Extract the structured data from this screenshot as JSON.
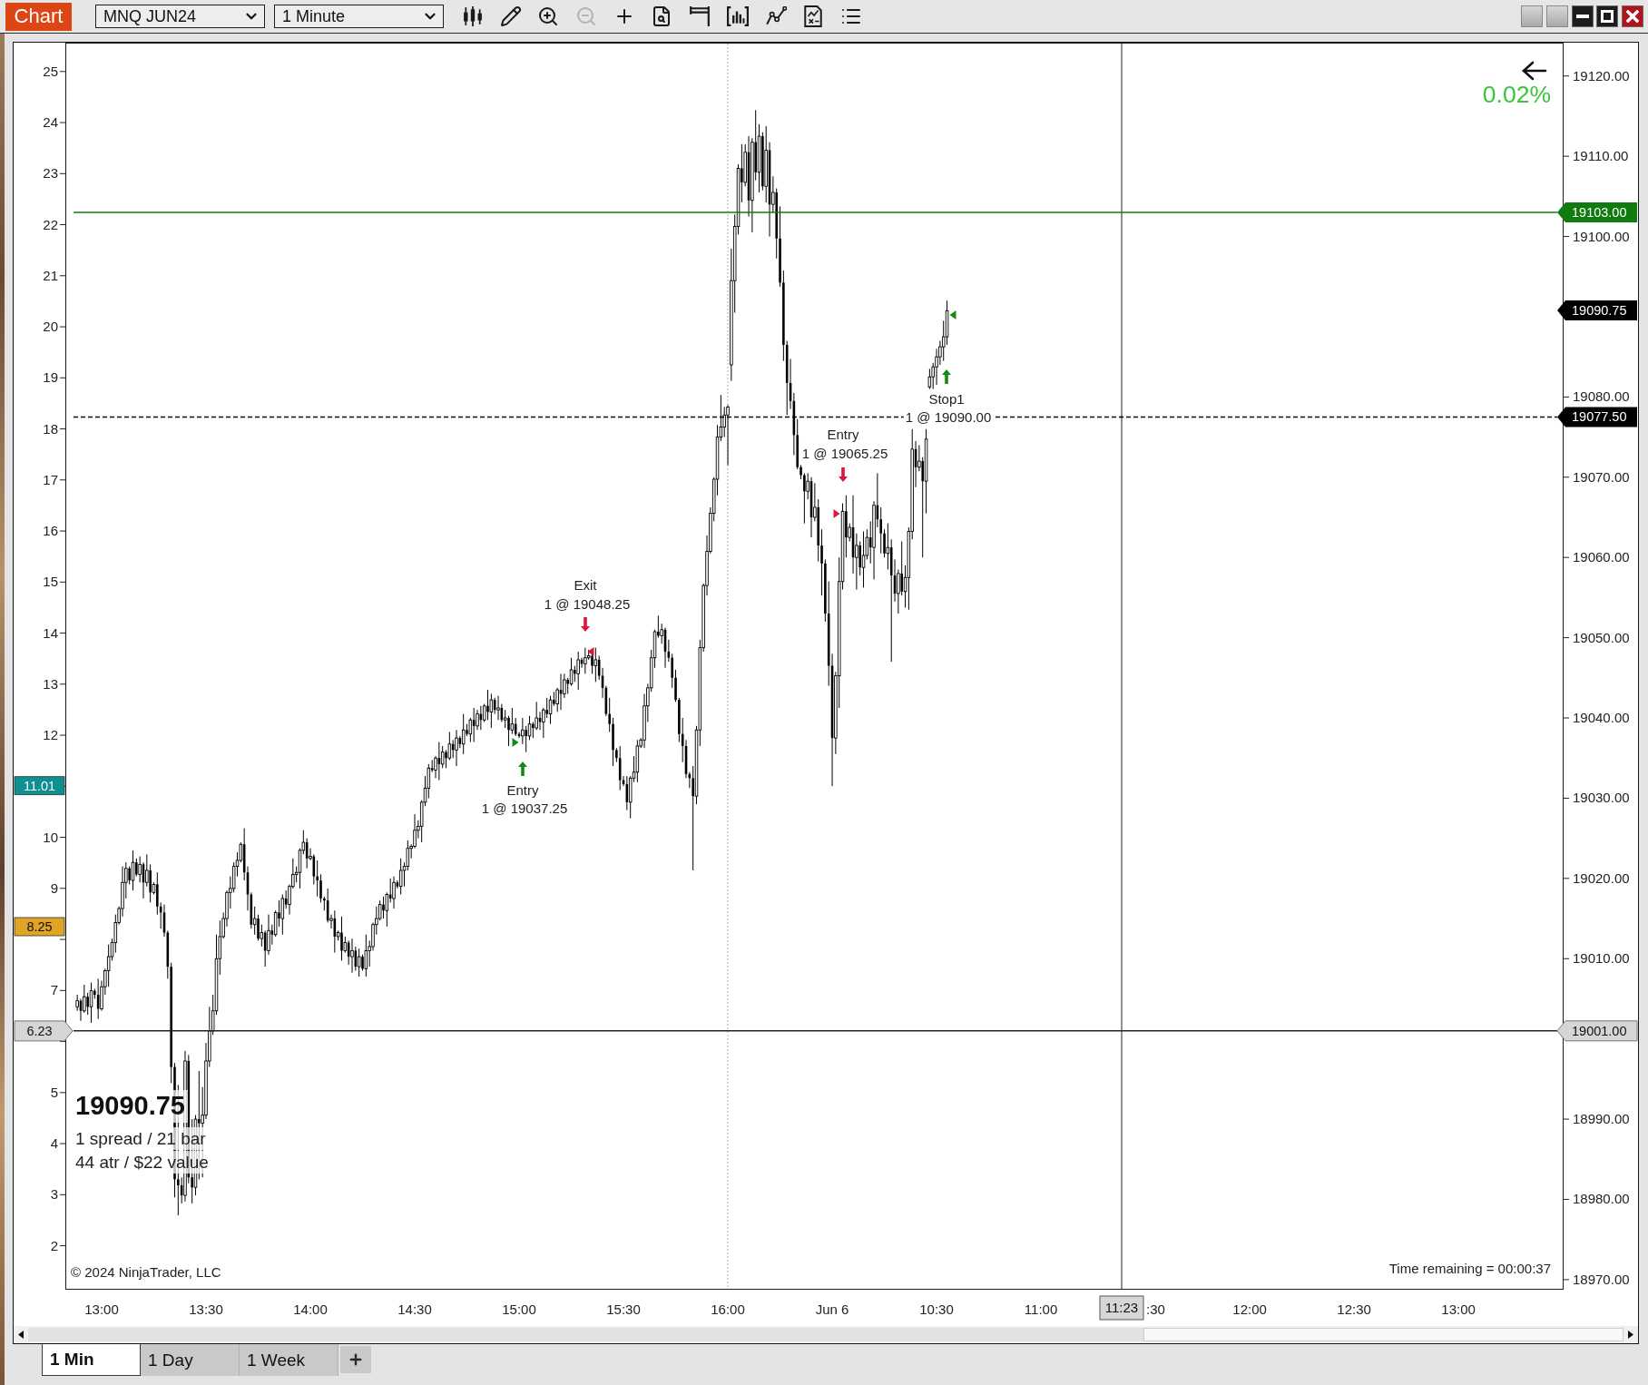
{
  "toolbar": {
    "title": "Chart",
    "instrument": {
      "value": "MNQ JUN24"
    },
    "interval": {
      "value": "1 Minute"
    },
    "tools": [
      {
        "disabled": false
      },
      {
        "disabled": false
      },
      {
        "disabled": false
      },
      {
        "disabled": true
      },
      {
        "disabled": false
      },
      {
        "disabled": false
      },
      {
        "disabled": false
      },
      {
        "disabled": false
      },
      {
        "disabled": false
      },
      {
        "disabled": false
      },
      {
        "disabled": false
      }
    ]
  },
  "chart": {
    "chart_data": {
      "type": "candlestick",
      "categories": [
        null,
        null,
        null,
        null,
        null,
        null,
        null,
        "13:00",
        null,
        null,
        null,
        null,
        null,
        null,
        null,
        null,
        null,
        null,
        null,
        null,
        null,
        null,
        null,
        null,
        null,
        null,
        null,
        null,
        null,
        null,
        null,
        null,
        null,
        null,
        null,
        null,
        null,
        "13:30",
        null,
        null,
        null,
        null,
        null,
        null,
        null,
        null,
        null,
        null,
        null,
        null,
        null,
        null,
        null,
        null,
        null,
        null,
        null,
        null,
        null,
        null,
        null,
        null,
        null,
        null,
        null,
        null,
        null,
        "14:00",
        null,
        null,
        null,
        null,
        null,
        null,
        null,
        null,
        null,
        null,
        null,
        null,
        null,
        null,
        null,
        null,
        null,
        null,
        null,
        null,
        null,
        null,
        null,
        null,
        null,
        null,
        null,
        null,
        null,
        "14:30",
        null,
        null,
        null,
        null,
        null,
        null,
        null,
        null,
        null,
        null,
        null,
        null,
        null,
        null,
        null,
        null,
        null,
        null,
        null,
        null,
        null,
        null,
        null,
        null,
        null,
        null,
        null,
        null,
        null,
        "15:00",
        null,
        null,
        null,
        null,
        null,
        null,
        null,
        null,
        null,
        null,
        null,
        null,
        null,
        null,
        null,
        null,
        null,
        null,
        null,
        null,
        null,
        null,
        null,
        null,
        null,
        null,
        null,
        null,
        null,
        "15:30",
        null,
        null,
        null,
        null,
        null,
        null,
        null,
        null,
        null,
        null,
        null,
        null,
        null,
        null,
        null,
        null,
        null,
        null,
        null,
        null,
        null,
        null,
        null,
        null,
        null,
        null,
        null,
        null,
        null,
        "16:00",
        null,
        null,
        null,
        null,
        null,
        null,
        null,
        null,
        null,
        null,
        null,
        null,
        null,
        null,
        null,
        null,
        null,
        null,
        null,
        null,
        null,
        null,
        null,
        null,
        null,
        null,
        null,
        null,
        null,
        "Jun 6",
        null,
        null,
        null,
        null,
        null,
        null,
        null,
        null,
        null,
        null,
        null,
        null,
        null,
        null,
        null,
        null,
        null,
        null,
        null,
        null,
        null,
        null,
        null,
        null,
        null,
        null,
        null,
        null,
        null,
        "10:30",
        null,
        null,
        null,
        null,
        null,
        null,
        null,
        null,
        null,
        null,
        null,
        null,
        null,
        null,
        null,
        null,
        null,
        null,
        null,
        null,
        null,
        null,
        null,
        null,
        null,
        null,
        null,
        null,
        null,
        "11:00",
        null,
        null,
        null,
        null,
        null,
        null,
        null,
        null,
        null,
        null,
        null,
        null,
        null,
        null,
        null,
        null,
        null,
        null,
        null,
        null,
        null,
        null,
        null,
        null,
        null,
        null,
        null,
        null,
        null,
        null,
        null,
        null,
        null,
        null,
        null,
        null,
        null,
        null,
        null,
        null,
        null,
        null,
        null,
        null,
        null,
        null,
        null,
        null,
        null,
        null,
        null,
        null,
        null,
        null,
        null,
        null,
        null,
        null,
        null,
        "12:00",
        null,
        null,
        null,
        null,
        null,
        null,
        null,
        null,
        null,
        null,
        null,
        null,
        null,
        null,
        null,
        null,
        null,
        null,
        null,
        null,
        null,
        null,
        null,
        null,
        null,
        null,
        null,
        null,
        null,
        "12:30",
        null,
        null,
        null,
        null,
        null,
        null,
        null,
        null,
        null,
        null,
        null,
        null,
        null,
        null,
        null,
        null,
        null,
        null,
        null,
        null,
        null,
        null,
        null,
        null,
        null,
        null,
        null,
        null,
        null,
        "13:00",
        null,
        null,
        null,
        null,
        null,
        null,
        null,
        null,
        null,
        null,
        null,
        null,
        null,
        null,
        null,
        null,
        null,
        null,
        null,
        null,
        null,
        null,
        null,
        null,
        null,
        null,
        null,
        null,
        null,
        null
      ],
      "ohlc": [
        [
          19004,
          19005.5,
          19003.5,
          19004.75
        ],
        [
          19004.75,
          19005,
          19002.25,
          19003.5
        ],
        [
          19003.5,
          19006.75,
          19003.25,
          19005.25
        ],
        [
          19005.25,
          19005.75,
          19003,
          19004
        ],
        [
          19004,
          19007,
          19002,
          19006
        ],
        [
          19006,
          19006.25,
          19005,
          19005.5
        ],
        [
          19005.5,
          19007.5,
          19002.5,
          19003.75
        ],
        [
          19003.75,
          19007.25,
          19003.5,
          19006.5
        ],
        [
          19006.5,
          19008.75,
          19005.5,
          19008.5
        ],
        [
          19008.5,
          19011.75,
          19006.5,
          19010.25
        ],
        [
          19010.25,
          19012.5,
          19009.75,
          19012
        ],
        [
          19012,
          19015.5,
          19010.75,
          19014.5
        ],
        [
          19014.5,
          19016.5,
          19014.25,
          19016.25
        ],
        [
          19016.25,
          19021.5,
          19015.25,
          19019.5
        ],
        [
          19019.5,
          19022,
          19017.5,
          19021.25
        ],
        [
          19021.25,
          19021.5,
          19019.25,
          19019.75
        ],
        [
          19019.75,
          19023.5,
          19018.5,
          19022
        ],
        [
          19022,
          19022.5,
          19020.25,
          19020.5
        ],
        [
          19020.5,
          19022.75,
          19019.5,
          19021.75
        ],
        [
          19021.75,
          19022,
          19017.5,
          19019.5
        ],
        [
          19019.5,
          19023,
          19019,
          19021
        ],
        [
          19021,
          19021.75,
          19017,
          19018.25
        ],
        [
          19018.25,
          19019.5,
          19018,
          19019.25
        ],
        [
          19019.25,
          19020.75,
          19015.5,
          19016.5
        ],
        [
          19016.5,
          19017,
          19013.75,
          19015.75
        ],
        [
          19015.75,
          19016.75,
          19012.75,
          19013.25
        ],
        [
          19013.25,
          19013.5,
          19007.5,
          19009
        ],
        [
          19009,
          19009.5,
          18994.5,
          18996.5
        ],
        [
          18996.5,
          18997,
          18980.25,
          18982.5
        ],
        [
          18982.5,
          18994.25,
          18978,
          18981.75
        ],
        [
          18981.75,
          18982.75,
          18979.5,
          18980.5
        ],
        [
          18980.5,
          18998.5,
          18979.75,
          18997.25
        ],
        [
          18997.25,
          18998,
          18982,
          18982.75
        ],
        [
          18982.75,
          18990,
          18979.5,
          18981.5
        ],
        [
          18981.5,
          18990.5,
          18980.5,
          18990
        ],
        [
          18990,
          18996,
          18982.5,
          18989.5
        ],
        [
          18989.5,
          18994,
          18982.75,
          18990.5
        ],
        [
          18990.5,
          18999.5,
          18990,
          18997.25
        ],
        [
          18997.25,
          19004,
          18996.5,
          19001
        ],
        [
          19001,
          19005.5,
          19000.5,
          19003.5
        ],
        [
          19003.5,
          19013,
          19003,
          19010
        ],
        [
          19010,
          19014.75,
          19008,
          19012.75
        ],
        [
          19012.75,
          19015.75,
          19012.5,
          19015
        ],
        [
          19015,
          19018.5,
          19014,
          19018.25
        ],
        [
          19018.25,
          19020.25,
          19016.25,
          19018.75
        ],
        [
          19018.75,
          19022,
          19018.25,
          19021.5
        ],
        [
          19021.5,
          19023.25,
          19020.25,
          19022.25
        ],
        [
          19022.25,
          19024.5,
          19022,
          19024.25
        ],
        [
          19024.25,
          19026.25,
          19019.75,
          19020.75
        ],
        [
          19020.75,
          19021.5,
          19016,
          19018
        ],
        [
          19018,
          19018.25,
          19013.75,
          19014.25
        ],
        [
          19014.25,
          19016.5,
          19013,
          19015
        ],
        [
          19015,
          19015.5,
          19012.25,
          19012.5
        ],
        [
          19012.5,
          19014.25,
          19011.5,
          19013.25
        ],
        [
          19013.25,
          19013.5,
          19009,
          19011
        ],
        [
          19011,
          19015.5,
          19010.5,
          19013.5
        ],
        [
          19013.5,
          19014.25,
          19011.75,
          19013
        ],
        [
          19013,
          19016,
          19012.75,
          19015.75
        ],
        [
          19015.75,
          19017.25,
          19014,
          19015
        ],
        [
          19015,
          19018,
          19013,
          19017.5
        ],
        [
          19017.5,
          19018.5,
          19016.25,
          19016.75
        ],
        [
          19016.75,
          19019.25,
          19015.5,
          19019
        ],
        [
          19019,
          19022.5,
          19018.75,
          19020.5
        ],
        [
          19020.5,
          19021.5,
          19019.5,
          19020.75
        ],
        [
          19020.75,
          19023.75,
          19018.75,
          19023.5
        ],
        [
          19023.5,
          19026,
          19023,
          19024.5
        ],
        [
          19024.5,
          19025,
          19021.25,
          19022.5
        ],
        [
          19022.5,
          19023.75,
          19022.25,
          19022.75
        ],
        [
          19022.75,
          19023,
          19019.25,
          19020.25
        ],
        [
          19020.25,
          19022.25,
          19017.75,
          19019.75
        ],
        [
          19019.75,
          19020.5,
          19017,
          19017.5
        ],
        [
          19017.5,
          19017.75,
          19016,
          19017.25
        ],
        [
          19017.25,
          19018.75,
          19014.5,
          19014.75
        ],
        [
          19014.75,
          19015.5,
          19013.75,
          19015
        ],
        [
          19015,
          19016,
          19010.75,
          19012.75
        ],
        [
          19012.75,
          19013.5,
          19012.25,
          19013.25
        ],
        [
          19013.25,
          19015.25,
          19009.75,
          19011
        ],
        [
          19011,
          19012.75,
          19010.75,
          19012
        ],
        [
          19012,
          19012.25,
          19009.25,
          19010.25
        ],
        [
          19010.25,
          19012.5,
          19008.25,
          19011
        ],
        [
          19011,
          19011.5,
          19008.5,
          19009
        ],
        [
          19009,
          19011.25,
          19007.75,
          19010.25
        ],
        [
          19010.25,
          19010.5,
          19008.5,
          19008.75
        ],
        [
          19008.75,
          19013,
          19007.75,
          19011
        ],
        [
          19011,
          19012.25,
          19009,
          19011.5
        ],
        [
          19011.5,
          19014.5,
          19011,
          19014.25
        ],
        [
          19014.25,
          19016.5,
          19013,
          19015
        ],
        [
          19015,
          19017.25,
          19014.75,
          19016.75
        ],
        [
          19016.75,
          19017.75,
          19015,
          19016
        ],
        [
          19016,
          19018.25,
          19014,
          19018
        ],
        [
          19018,
          19020,
          19017,
          19017.5
        ],
        [
          19017.5,
          19020.25,
          19016.25,
          19019.5
        ],
        [
          19019.5,
          19019.75,
          19018.75,
          19019
        ],
        [
          19019,
          19022.5,
          19018,
          19021
        ],
        [
          19021,
          19022,
          19019,
          19021.5
        ],
        [
          19021.5,
          19024.75,
          19021,
          19023.75
        ],
        [
          19023.75,
          19024.25,
          19022.5,
          19024
        ],
        [
          19024,
          19028,
          19023.75,
          19026
        ],
        [
          19026,
          19027.25,
          19025,
          19026.5
        ],
        [
          19026.5,
          19029.75,
          19024.5,
          19029.5
        ],
        [
          19029.5,
          19032.75,
          19029,
          19031.25
        ],
        [
          19031.25,
          19034.25,
          19030,
          19033.75
        ],
        [
          19033.75,
          19034.75,
          19033.25,
          19033.5
        ],
        [
          19033.5,
          19035.25,
          19032.5,
          19035
        ],
        [
          19035,
          19037,
          19032.25,
          19034.25
        ],
        [
          19034.25,
          19036.5,
          19033.75,
          19035.75
        ],
        [
          19035.75,
          19036,
          19033.75,
          19035
        ],
        [
          19035,
          19038.25,
          19034.75,
          19036.75
        ],
        [
          19036.75,
          19037.25,
          19035,
          19036
        ],
        [
          19036,
          19038.5,
          19034,
          19037.5
        ],
        [
          19037.5,
          19037.75,
          19036.25,
          19036.75
        ],
        [
          19036.75,
          19040.5,
          19035.5,
          19038.5
        ],
        [
          19038.5,
          19039.25,
          19037.75,
          19038
        ],
        [
          19038,
          19040,
          19037,
          19039.75
        ],
        [
          19039.75,
          19041.25,
          19037,
          19039
        ],
        [
          19039,
          19041,
          19038.5,
          19040.5
        ],
        [
          19040.5,
          19041.5,
          19038.5,
          19039.75
        ],
        [
          19039.75,
          19041.75,
          19039.5,
          19041.5
        ],
        [
          19041.5,
          19043.5,
          19039.75,
          19040.75
        ],
        [
          19040.75,
          19043,
          19038.75,
          19042.25
        ],
        [
          19042.25,
          19042.5,
          19040.5,
          19041
        ],
        [
          19041,
          19042.75,
          19039.75,
          19041.25
        ],
        [
          19041.25,
          19041.75,
          19039.5,
          19039.75
        ],
        [
          19039.75,
          19041,
          19038.75,
          19040
        ],
        [
          19040,
          19040.25,
          19036.5,
          19038.5
        ],
        [
          19038.5,
          19041.25,
          19038,
          19039.25
        ],
        [
          19039.25,
          19040,
          19037.75,
          19038
        ],
        [
          19038,
          19038.25,
          19037.5,
          19037.75
        ],
        [
          19037.75,
          19040,
          19036.75,
          19038.5
        ],
        [
          19038.5,
          19039,
          19035.75,
          19037.75
        ],
        [
          19037.75,
          19040.25,
          19037.25,
          19039.25
        ],
        [
          19039.25,
          19039.5,
          19037.5,
          19038.75
        ],
        [
          19038.75,
          19042,
          19038.5,
          19040
        ],
        [
          19040,
          19040.75,
          19038.5,
          19039.5
        ],
        [
          19039.5,
          19041.25,
          19037.5,
          19041
        ],
        [
          19041,
          19042.5,
          19040,
          19040.5
        ],
        [
          19040.5,
          19042.75,
          19039.25,
          19042.25
        ],
        [
          19042.25,
          19043.25,
          19041.5,
          19041.75
        ],
        [
          19041.75,
          19043.75,
          19040.75,
          19043.5
        ],
        [
          19043.5,
          19045.5,
          19041,
          19043
        ],
        [
          19043,
          19045.5,
          19042.5,
          19044.75
        ],
        [
          19044.75,
          19045,
          19043,
          19044.25
        ],
        [
          19044.25,
          19047.5,
          19044,
          19046
        ],
        [
          19046,
          19046.5,
          19044.5,
          19045.5
        ],
        [
          19045.5,
          19048.25,
          19043.5,
          19047.25
        ],
        [
          19047.25,
          19047.5,
          19046.25,
          19046.75
        ],
        [
          19046.75,
          19048.75,
          19045.5,
          19047.5
        ],
        [
          19047.5,
          19048.5,
          19047.25,
          19047.75
        ],
        [
          19047.75,
          19048,
          19045.5,
          19046.5
        ],
        [
          19046.5,
          19048.75,
          19044.5,
          19047.25
        ],
        [
          19047.25,
          19047.75,
          19044.75,
          19045.25
        ],
        [
          19045.25,
          19046.25,
          19042.5,
          19043.75
        ],
        [
          19043.75,
          19044,
          19040.25,
          19040.5
        ],
        [
          19040.5,
          19042.5,
          19038.25,
          19039.25
        ],
        [
          19039.25,
          19040,
          19034,
          19036
        ],
        [
          19036,
          19036.25,
          19034.5,
          19035
        ],
        [
          19035,
          19036.5,
          19031,
          19032.25
        ],
        [
          19032.25,
          19032.75,
          19031.5,
          19031.75
        ],
        [
          19031.75,
          19032.75,
          19028.5,
          19029.5
        ],
        [
          19029.5,
          19032.75,
          19027.5,
          19032.5
        ],
        [
          19032.5,
          19035.25,
          19032,
          19033.25
        ],
        [
          19033.25,
          19037.25,
          19032,
          19036.5
        ],
        [
          19036.5,
          19037.5,
          19036.25,
          19037.25
        ],
        [
          19037.25,
          19043,
          19036.25,
          19041.5
        ],
        [
          19041.5,
          19044.25,
          19039.5,
          19043.75
        ],
        [
          19043.75,
          19048.5,
          19043.25,
          19047.5
        ],
        [
          19047.5,
          19051,
          19046.25,
          19050.75
        ],
        [
          19050.75,
          19052.75,
          19050,
          19050.25
        ],
        [
          19050.25,
          19051.75,
          19049.25,
          19051
        ],
        [
          19051,
          19051.25,
          19046.25,
          19048.25
        ],
        [
          19048.25,
          19049.75,
          19047,
          19047.5
        ],
        [
          19047.5,
          19048,
          19043.75,
          19045
        ],
        [
          19045,
          19046,
          19042,
          19042.25
        ],
        [
          19042.25,
          19042.5,
          19037,
          19038
        ],
        [
          19038,
          19040,
          19034.5,
          19036.5
        ],
        [
          19036.5,
          19037.25,
          19032.5,
          19033
        ],
        [
          19033,
          19033.25,
          19031.25,
          19032.5
        ],
        [
          19032.5,
          19034,
          19021,
          19030.25
        ],
        [
          19030.25,
          19039,
          19029.25,
          19038.5
        ],
        [
          19038.5,
          19049.75,
          19036.5,
          19048.75
        ],
        [
          19048.75,
          19056.75,
          19048.25,
          19056.5
        ],
        [
          19056.5,
          19062.75,
          19055.25,
          19060.75
        ],
        [
          19060.75,
          19066.25,
          19060.5,
          19065.5
        ],
        [
          19065.5,
          19070,
          19064.5,
          19069.75
        ],
        [
          19069.75,
          19076.5,
          19067.75,
          19075
        ],
        [
          19075,
          19080.25,
          19074.5,
          19076.25
        ],
        [
          19076.25,
          19078.75,
          19075,
          19077.75
        ],
        [
          19077.75,
          19079,
          19071.5,
          19078.75
        ],
        [
          19084,
          19098.5,
          19082,
          19094.5
        ],
        [
          19094.5,
          19102.75,
          19090.5,
          19101.25
        ],
        [
          19101.25,
          19109,
          19100.25,
          19108.5
        ],
        [
          19108.5,
          19111.5,
          19104.25,
          19106.75
        ],
        [
          19106.75,
          19111.5,
          19106.25,
          19110.5
        ],
        [
          19110.5,
          19112.5,
          19102.5,
          19104.5
        ],
        [
          19104.5,
          19112.25,
          19100.5,
          19111.75
        ],
        [
          19111.75,
          19115.75,
          19107,
          19108
        ],
        [
          19108,
          19114,
          19105.5,
          19112.5
        ],
        [
          19112.5,
          19113,
          19105.75,
          19106.25
        ],
        [
          19106.25,
          19113.75,
          19104.25,
          19110.75
        ],
        [
          19110.75,
          19111.75,
          19100,
          19104
        ],
        [
          19104,
          19107.5,
          19103,
          19105.5
        ],
        [
          19105.5,
          19106,
          19097.25,
          19099.75
        ],
        [
          19099.75,
          19103.75,
          19093.75,
          19094.25
        ],
        [
          19094.25,
          19095.75,
          19084.5,
          19086.5
        ],
        [
          19086.5,
          19087,
          19077.75,
          19081.75
        ],
        [
          19081.75,
          19084.75,
          19078.5,
          19079.5
        ],
        [
          19079.5,
          19080.5,
          19072.75,
          19075.25
        ],
        [
          19075.25,
          19077.25,
          19071,
          19071.25
        ],
        [
          19071.25,
          19071.5,
          19069.75,
          19070.25
        ],
        [
          19070.25,
          19070.5,
          19064.25,
          19068.25
        ],
        [
          19068.25,
          19070.5,
          19067.25,
          19069.5
        ],
        [
          19069.5,
          19070,
          19062.5,
          19065
        ],
        [
          19065,
          19069.25,
          19064.5,
          19066.25
        ],
        [
          19066.25,
          19067.25,
          19059.5,
          19061.5
        ],
        [
          19061.5,
          19063.5,
          19055.25,
          19059.25
        ],
        [
          19059.25,
          19059.75,
          19052,
          19053
        ],
        [
          19053,
          19057,
          19044,
          19046.5
        ],
        [
          19046.5,
          19048,
          19031.5,
          19037.5
        ],
        [
          19037.5,
          19045.75,
          19035.5,
          19045.25
        ],
        [
          19045.25,
          19060,
          19041.25,
          19057
        ],
        [
          19057,
          19066.75,
          19056,
          19065.75
        ],
        [
          19065.75,
          19067.75,
          19060,
          19062.5
        ],
        [
          19062.5,
          19064.25,
          19062,
          19063.75
        ],
        [
          19063.75,
          19067.75,
          19058,
          19060
        ],
        [
          19060,
          19063,
          19056,
          19061.5
        ],
        [
          19061.5,
          19062,
          19057.75,
          19058.75
        ],
        [
          19058.75,
          19063.25,
          19056.25,
          19060.25
        ],
        [
          19060.25,
          19063.5,
          19059.75,
          19062.5
        ],
        [
          19062.5,
          19064.5,
          19059.25,
          19061.25
        ],
        [
          19061.25,
          19067,
          19057.25,
          19066.5
        ],
        [
          19066.5,
          19070.5,
          19063.75,
          19064.75
        ],
        [
          19064.75,
          19066.25,
          19060.5,
          19063
        ],
        [
          19063,
          19063.5,
          19060,
          19060.5
        ],
        [
          19060.5,
          19064.25,
          19058.5,
          19061.25
        ],
        [
          19061.25,
          19062.25,
          19047,
          19057.75
        ],
        [
          19057.75,
          19059.75,
          19054.5,
          19055.5
        ],
        [
          19055.5,
          19058.5,
          19053,
          19058
        ],
        [
          19058,
          19062,
          19055.25,
          19055.75
        ],
        [
          19055.75,
          19059,
          19053.75,
          19057.5
        ],
        [
          19057.5,
          19063.75,
          19053.5,
          19063.25
        ],
        [
          19063.25,
          19076,
          19062.25,
          19073.5
        ],
        [
          19073.5,
          19074.5,
          19068.75,
          19071.25
        ],
        [
          19071.25,
          19074,
          19070.75,
          19072
        ],
        [
          19072,
          19072.5,
          19060,
          19069.5
        ],
        [
          19069.5,
          19076,
          19065.5,
          19074.75
        ],
        [
          19081.25,
          19083.5,
          19081,
          19082.5
        ],
        [
          19082.5,
          19084.25,
          19081,
          19083.75
        ],
        [
          19083.75,
          19086,
          19081.5,
          19085
        ],
        [
          19085,
          19087,
          19084,
          19086.25
        ],
        [
          19086.25,
          19089.5,
          19084.5,
          19087.5
        ],
        [
          19087.5,
          19092,
          19086.5,
          19090.75
        ],
        null,
        null,
        null,
        null,
        null,
        null,
        null,
        null,
        null,
        null,
        null,
        null,
        null,
        null,
        null,
        null,
        null,
        null,
        null,
        null,
        null,
        null,
        null,
        null,
        null,
        null,
        null,
        null,
        null,
        null,
        null,
        null,
        null,
        null,
        null,
        null,
        null,
        null,
        null,
        null,
        null,
        null,
        null,
        null,
        null,
        null,
        null,
        null,
        null,
        null,
        null,
        null,
        null,
        null,
        null,
        null,
        null,
        null,
        null,
        null,
        null,
        null,
        null,
        null,
        null,
        null,
        null,
        null,
        null,
        null,
        null,
        null,
        null,
        null,
        null,
        null,
        null,
        null,
        null,
        null,
        null,
        null,
        null,
        null,
        null,
        null,
        null,
        null,
        null,
        null,
        null,
        null,
        null,
        null,
        null,
        null,
        null,
        null,
        null,
        null,
        null,
        null,
        null,
        null,
        null,
        null,
        null,
        null,
        null,
        null,
        null,
        null,
        null,
        null,
        null,
        null,
        null,
        null,
        null,
        null,
        null,
        null,
        null,
        null,
        null,
        null,
        null,
        null,
        null,
        null,
        null,
        null,
        null,
        null,
        null,
        null,
        null,
        null,
        null,
        null,
        null,
        null,
        null,
        null,
        null,
        null,
        null,
        null,
        null,
        null,
        null,
        null,
        null,
        null,
        null,
        null,
        null,
        null,
        null,
        null,
        null,
        null,
        null,
        null,
        null,
        null,
        null,
        null,
        null,
        null,
        null,
        null,
        null,
        null,
        null,
        null,
        null
      ],
      "ylim": [
        18968.8,
        19124.1
      ],
      "yticks": [
        {
          "value": 19120,
          "label": "19120.00"
        },
        {
          "value": 19110,
          "label": "19110.00"
        },
        {
          "value": 19100,
          "label": "19100.00"
        },
        {
          "value": 19080,
          "label": "19080.00"
        },
        {
          "value": 19070,
          "label": "19070.00"
        },
        {
          "value": 19060,
          "label": "19060.00"
        },
        {
          "value": 19050,
          "label": "19050.00"
        },
        {
          "value": 19040,
          "label": "19040.00"
        },
        {
          "value": 19030,
          "label": "19030.00"
        },
        {
          "value": 19020,
          "label": "19020.00"
        },
        {
          "value": 19010,
          "label": "19010.00"
        },
        {
          "value": 18990,
          "label": "18990.00"
        },
        {
          "value": 18980,
          "label": "18980.00"
        },
        {
          "value": 18970,
          "label": "18970.00"
        }
      ],
      "ref_lines": [
        {
          "axis": "y",
          "value": 19103,
          "label": "19103.00",
          "color": "#107c10"
        },
        {
          "axis": "y",
          "value": 19077.5,
          "label": "19077.50",
          "color": "#000000"
        },
        {
          "axis": "y",
          "value": 19001,
          "label": "19001.00",
          "color": "#222222"
        }
      ]
    },
    "left_axis": {
      "labels": [
        "25",
        "24",
        "23",
        "22",
        "21",
        "20",
        "19",
        "18",
        "17",
        "16",
        "15",
        "14",
        "13",
        "12",
        "10",
        "9",
        "7",
        "5",
        "4",
        "3",
        "2"
      ]
    },
    "time_axis": {
      "partial_label": ":30"
    },
    "price_tags": [
      {
        "label": "19090.75",
        "color": "#000000"
      }
    ],
    "indicator_tags": [
      {
        "label": "11.01",
        "color": "#0f8f8f"
      },
      {
        "label": "8.25",
        "color": "#e0a526"
      }
    ],
    "crosshair": {
      "value": "6.23",
      "time": "11:23"
    },
    "trades": [
      {
        "kind": "buy",
        "title": "Entry",
        "detail": "1 @ 19037.25"
      },
      {
        "kind": "sell",
        "title": "Exit",
        "detail": "1 @ 19048.25"
      },
      {
        "kind": "sell",
        "title": "Entry",
        "detail": "1 @ 19065.25"
      },
      {
        "kind": "buy",
        "title": "Stop1",
        "detail": "1 @ 19090.00"
      }
    ],
    "change": "0.02%",
    "info": {
      "price": "19090.75",
      "lines": [
        "1 spread / 21 bar",
        "44 atr / $22 value"
      ]
    },
    "copyright": "© 2024 NinjaTrader, LLC",
    "time_remaining": "Time remaining = 00:00:37"
  },
  "tabs": [
    {
      "label": "1 Min",
      "selected": true
    },
    {
      "label": "1 Day",
      "selected": false
    },
    {
      "label": "1 Week",
      "selected": false
    }
  ]
}
